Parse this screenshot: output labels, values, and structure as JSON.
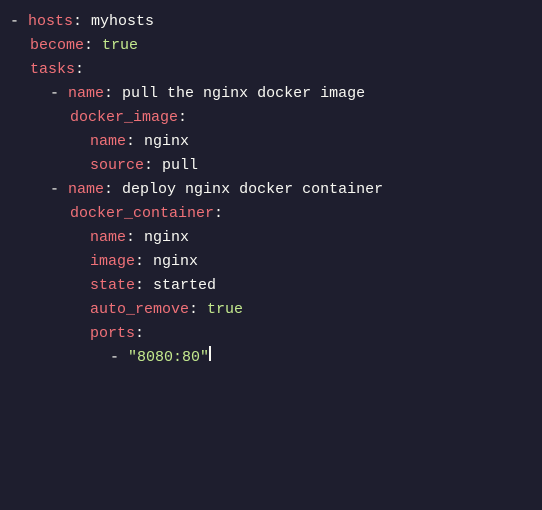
{
  "code": {
    "lines": [
      {
        "indent": 0,
        "content": [
          {
            "type": "dash",
            "text": "- "
          },
          {
            "type": "key",
            "text": "hosts"
          },
          {
            "type": "colon",
            "text": ": "
          },
          {
            "type": "val-white",
            "text": "myhosts"
          }
        ]
      },
      {
        "indent": 1,
        "content": [
          {
            "type": "key",
            "text": "become"
          },
          {
            "type": "colon",
            "text": ": "
          },
          {
            "type": "val-true",
            "text": "true"
          }
        ]
      },
      {
        "indent": 1,
        "content": [
          {
            "type": "key",
            "text": "tasks"
          },
          {
            "type": "colon",
            "text": ":"
          }
        ]
      },
      {
        "indent": 2,
        "content": [
          {
            "type": "dash",
            "text": "- "
          },
          {
            "type": "key",
            "text": "name"
          },
          {
            "type": "colon",
            "text": ": "
          },
          {
            "type": "val-white",
            "text": "pull the nginx docker image"
          }
        ]
      },
      {
        "indent": 3,
        "content": [
          {
            "type": "key",
            "text": "docker_image"
          },
          {
            "type": "colon",
            "text": ":"
          }
        ]
      },
      {
        "indent": 4,
        "content": [
          {
            "type": "key",
            "text": "name"
          },
          {
            "type": "colon",
            "text": ": "
          },
          {
            "type": "val-white",
            "text": "nginx"
          }
        ]
      },
      {
        "indent": 4,
        "content": [
          {
            "type": "key",
            "text": "source"
          },
          {
            "type": "colon",
            "text": ": "
          },
          {
            "type": "val-white",
            "text": "pull"
          }
        ]
      },
      {
        "indent": 0,
        "content": []
      },
      {
        "indent": 2,
        "content": [
          {
            "type": "dash",
            "text": "- "
          },
          {
            "type": "key",
            "text": "name"
          },
          {
            "type": "colon",
            "text": ": "
          },
          {
            "type": "val-white",
            "text": "deploy nginx docker container"
          }
        ]
      },
      {
        "indent": 3,
        "content": [
          {
            "type": "key",
            "text": "docker_container"
          },
          {
            "type": "colon",
            "text": ":"
          }
        ]
      },
      {
        "indent": 4,
        "content": [
          {
            "type": "key",
            "text": "name"
          },
          {
            "type": "colon",
            "text": ": "
          },
          {
            "type": "val-white",
            "text": "nginx"
          }
        ]
      },
      {
        "indent": 4,
        "content": [
          {
            "type": "key",
            "text": "image"
          },
          {
            "type": "colon",
            "text": ": "
          },
          {
            "type": "val-white",
            "text": "nginx"
          }
        ]
      },
      {
        "indent": 4,
        "content": [
          {
            "type": "key",
            "text": "state"
          },
          {
            "type": "colon",
            "text": ": "
          },
          {
            "type": "val-white",
            "text": "started"
          }
        ]
      },
      {
        "indent": 4,
        "content": [
          {
            "type": "key",
            "text": "auto_remove"
          },
          {
            "type": "colon",
            "text": ": "
          },
          {
            "type": "val-true",
            "text": "true"
          }
        ]
      },
      {
        "indent": 4,
        "content": [
          {
            "type": "key",
            "text": "ports"
          },
          {
            "type": "colon",
            "text": ":"
          }
        ]
      },
      {
        "indent": 5,
        "content": [
          {
            "type": "dash",
            "text": "- "
          },
          {
            "type": "val-str",
            "text": "\"8080:80\""
          },
          {
            "type": "cursor",
            "text": ""
          }
        ]
      }
    ]
  }
}
